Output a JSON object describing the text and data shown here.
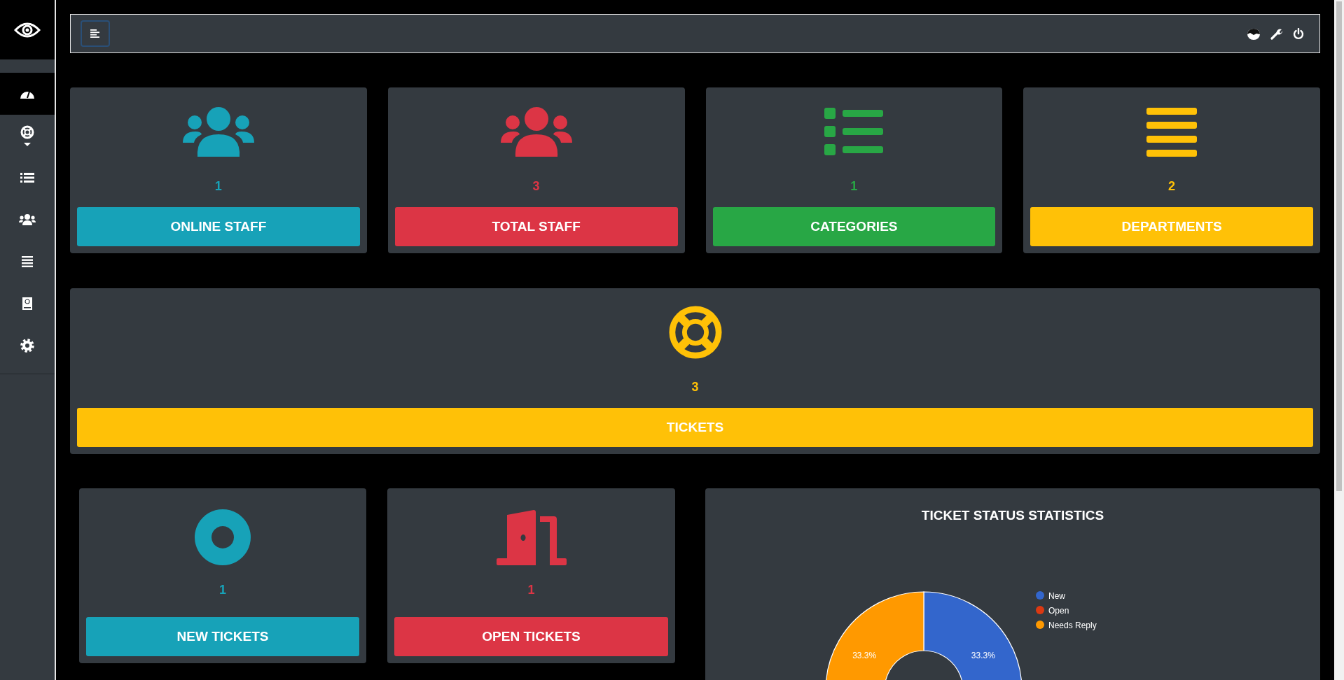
{
  "sidebar": {
    "items": [
      {
        "selected": true,
        "expandable": false
      },
      {
        "selected": false,
        "expandable": true
      },
      {
        "selected": false,
        "expandable": false
      },
      {
        "selected": false,
        "expandable": false
      },
      {
        "selected": false,
        "expandable": false
      },
      {
        "selected": false,
        "expandable": false
      },
      {
        "selected": false,
        "expandable": false
      }
    ]
  },
  "stat_cards": [
    {
      "count": "1",
      "label": "ONLINE STAFF",
      "color": "#17a2b8"
    },
    {
      "count": "3",
      "label": "TOTAL STAFF",
      "color": "#dc3545"
    },
    {
      "count": "1",
      "label": "CATEGORIES",
      "color": "#28a745"
    },
    {
      "count": "2",
      "label": "DEPARTMENTS",
      "color": "#ffc107"
    }
  ],
  "tickets_card": {
    "count": "3",
    "label": "TICKETS",
    "color": "#ffc107"
  },
  "ticket_cards": [
    {
      "count": "1",
      "label": "NEW TICKETS",
      "color": "#17a2b8"
    },
    {
      "count": "1",
      "label": "OPEN TICKETS",
      "color": "#dc3545"
    }
  ],
  "chart_data": {
    "type": "donut",
    "title": "TICKET STATUS STATISTICS",
    "categories": [
      "New",
      "Open",
      "Needs Reply"
    ],
    "values": [
      33.3,
      null,
      33.3
    ],
    "value_labels": [
      "33.3%",
      null,
      "33.3%"
    ],
    "legend": "right",
    "colors": [
      "#3366cc",
      "#dc3912",
      "#ff9900"
    ]
  }
}
